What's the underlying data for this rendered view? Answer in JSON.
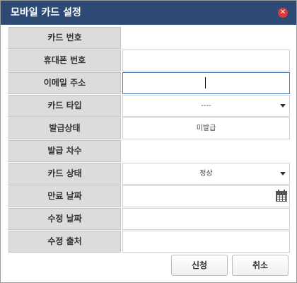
{
  "dialog": {
    "title": "모바일 카드 설정",
    "close_glyph": "✕"
  },
  "form": {
    "card_number": {
      "label": "카드 번호",
      "value": ""
    },
    "phone_number": {
      "label": "휴대폰 번호",
      "value": ""
    },
    "email": {
      "label": "이메일 주소",
      "value": ""
    },
    "card_type": {
      "label": "카드 타입",
      "selected": "----"
    },
    "issue_status": {
      "label": "발급상태",
      "value": "미발급"
    },
    "issue_count": {
      "label": "발급 차수",
      "value": ""
    },
    "card_status": {
      "label": "카드 상태",
      "selected": "정상"
    },
    "expiry_date": {
      "label": "만료 날짜",
      "value": ""
    },
    "modified_date": {
      "label": "수정 날짜",
      "value": ""
    },
    "modified_source": {
      "label": "수정 출처",
      "value": ""
    }
  },
  "buttons": {
    "apply": "신청",
    "cancel": "취소"
  },
  "colors": {
    "titlebar": "#2c4a73",
    "label_bg": "#dcdcdc",
    "close": "#d93a3a",
    "focus_border": "#4a7fc0"
  },
  "icons": [
    "close-icon",
    "dropdown-arrow-icon",
    "calendar-icon"
  ]
}
